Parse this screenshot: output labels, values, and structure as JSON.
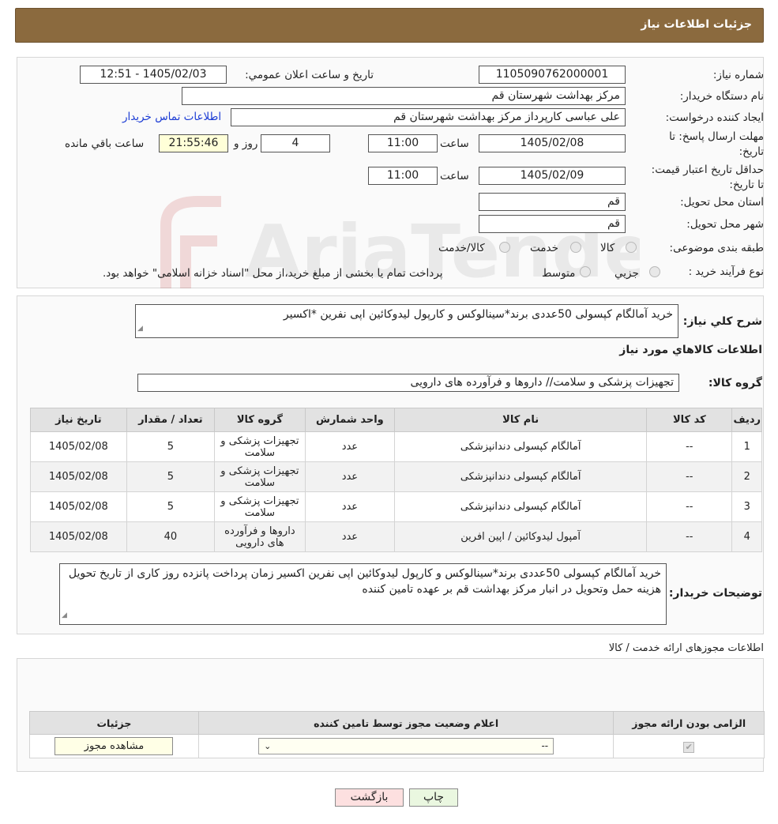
{
  "header": {
    "title": "جزئیات اطلاعات نیاز"
  },
  "form": {
    "need_number_label": "شماره نیاز:",
    "need_number": "1105090762000001",
    "announce_label": "تاریخ و ساعت اعلان عمومي:",
    "announce_value": "1405/02/03 - 12:51",
    "buyer_org_label": "نام دستگاه خريدار:",
    "buyer_org": "مرکز بهداشت شهرستان قم",
    "creator_label": "ايجاد کننده درخواست:",
    "creator": "علی عباسی کارپرداز مرکز بهداشت شهرستان قم",
    "contact_link": "اطلاعات تماس خريدار",
    "deadline_label": "مهلت ارسال پاسخ: تا تاريخ:",
    "deadline_date": "1405/02/08",
    "time_label": "ساعت",
    "deadline_time": "11:00",
    "days_value": "4",
    "days_label": "روز و",
    "remaining_time": "21:55:46",
    "remaining_label": "ساعت باقي مانده",
    "price_valid_label": "حداقل تاريخ اعتبار قيمت: تا تاريخ:",
    "price_valid_date": "1405/02/09",
    "price_valid_time": "11:00",
    "province_label": "استان محل تحويل:",
    "province": "قم",
    "city_label": "شهر محل تحويل:",
    "city": "قم",
    "category_label": "طبقه بندی موضوعی:",
    "category_options": [
      "کالا",
      "خدمت",
      "کالا/خدمت"
    ],
    "process_label": "نوع فرآيند خريد :",
    "process_options": [
      "جزيي",
      "متوسط"
    ],
    "process_note": "پرداخت تمام یا بخشی از مبلغ خرید،از محل \"اسناد خزانه اسلامی\" خواهد بود."
  },
  "summary": {
    "label": "شرح کلي نياز:",
    "value": "خرید آمالگام کپسولی 50عددی برند*سینالوکس و کارپول لیدوکائین اپی نفرین *اکسیر",
    "goods_info_title": "اطلاعات کالاهاي مورد نياز",
    "group_label": "گروه کالا:",
    "group_value": "تجهیزات پزشکی و سلامت// داروها و فرآورده های دارویی"
  },
  "items_table": {
    "headers": [
      "رديف",
      "کد کالا",
      "نام کالا",
      "واحد شمارش",
      "گروه کالا",
      "تعداد / مقدار",
      "تاريخ نياز"
    ],
    "rows": [
      [
        "1",
        "--",
        "آمالگام کپسولی دندانپزشکی",
        "عدد",
        "تجهیزات پزشکی و سلامت",
        "5",
        "1405/02/08"
      ],
      [
        "2",
        "--",
        "آمالگام کپسولی دندانپزشکی",
        "عدد",
        "تجهیزات پزشکی و سلامت",
        "5",
        "1405/02/08"
      ],
      [
        "3",
        "--",
        "آمالگام کپسولی دندانپزشکی",
        "عدد",
        "تجهیزات پزشکی و سلامت",
        "5",
        "1405/02/08"
      ],
      [
        "4",
        "--",
        "آمپول لیدوکائین / اپین افرین",
        "عدد",
        "داروها و فرآورده های دارویی",
        "40",
        "1405/02/08"
      ]
    ]
  },
  "buyer_notes": {
    "label": "توضيحات خريدار:",
    "value": "خرید آمالگام کپسولی 50عددی برند*سینالوکس و کارپول لیدوکائین اپی نفرین اکسیر زمان پرداخت پانزده روز کاری از تاریخ تحویل هزینه حمل وتحویل در انبار مرکز بهداشت قم بر عهده تامین کننده"
  },
  "permits": {
    "section_title": "اطلاعات مجوزهای ارائه خدمت / کالا",
    "headers": [
      "الزامی بودن ارائه مجوز",
      "اعلام وضعیت مجوز توسط تامین کننده",
      "جزئیات"
    ],
    "select_value": "--",
    "view_button": "مشاهده مجوز"
  },
  "buttons": {
    "print": "چاپ",
    "back": "بازگشت"
  },
  "watermark": {
    "text": "AriaTender.neT"
  },
  "colors": {
    "header_bg": "#8b6a3e",
    "link": "#1a3bd4",
    "back_btn_bg": "#fde0e0",
    "print_btn_bg": "#eaf7e0"
  }
}
